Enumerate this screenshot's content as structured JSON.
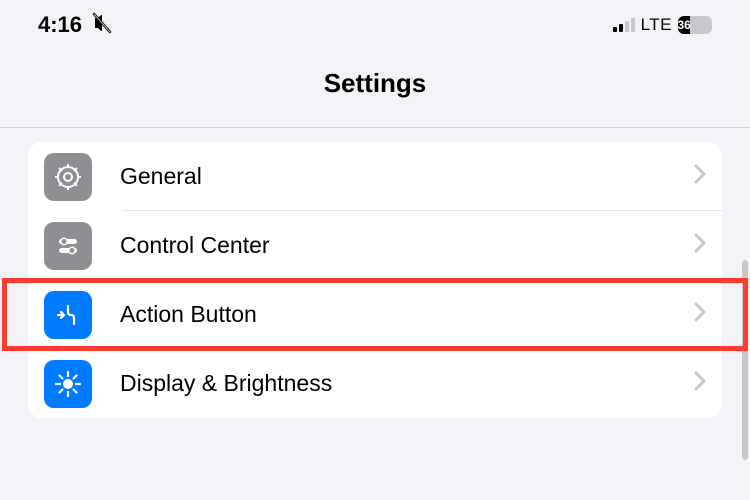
{
  "status": {
    "time": "4:16",
    "network": "LTE",
    "battery_level": "36"
  },
  "header": {
    "title": "Settings"
  },
  "items": [
    {
      "label": "General"
    },
    {
      "label": "Control Center"
    },
    {
      "label": "Action Button"
    },
    {
      "label": "Display & Brightness"
    }
  ],
  "colors": {
    "gray": "#8e8e93",
    "blue": "#007aff",
    "highlight": "#ff3b30"
  }
}
